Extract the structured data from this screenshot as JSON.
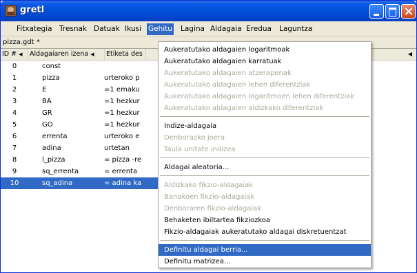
{
  "window": {
    "title": "gretl"
  },
  "menubar": {
    "items": [
      {
        "label": "Fitxategia",
        "active": false
      },
      {
        "label": "Tresnak",
        "active": false
      },
      {
        "label": "Datuak",
        "active": false
      },
      {
        "label": "Ikusi",
        "active": false
      },
      {
        "label": "Gehitu",
        "active": true
      },
      {
        "label": "Lagina",
        "active": false
      },
      {
        "label": "Aldagaia",
        "active": false
      },
      {
        "label": "Eredua",
        "active": false
      },
      {
        "label": "Laguntza",
        "active": false
      }
    ]
  },
  "file": {
    "name": "pizza.gdt *"
  },
  "table": {
    "headers": {
      "id": "ID #",
      "name": "Aldagaiaren izena",
      "label": "Etiketa des"
    },
    "rows": [
      {
        "id": "0",
        "name": "const",
        "label": ""
      },
      {
        "id": "1",
        "name": "pizza",
        "label": "urteroko p"
      },
      {
        "id": "2",
        "name": "E",
        "label": "=1 emaku"
      },
      {
        "id": "3",
        "name": "BA",
        "label": "=1 hezkur"
      },
      {
        "id": "4",
        "name": "GR",
        "label": "=1 hezkur"
      },
      {
        "id": "5",
        "name": "GO",
        "label": "=1 hezkur"
      },
      {
        "id": "6",
        "name": "errenta",
        "label": "urteroko e"
      },
      {
        "id": "7",
        "name": "adina",
        "label": "urtetan"
      },
      {
        "id": "8",
        "name": "l_pizza",
        "label": "= pizza -re"
      },
      {
        "id": "9",
        "name": "sq_errenta",
        "label": "= errenta"
      },
      {
        "id": "10",
        "name": "sq_adina",
        "label": "= adina ka"
      }
    ],
    "selected_row": 10
  },
  "dropdown": {
    "groups": [
      [
        {
          "label": "Aukeratutako aldagaien logaritmoak",
          "enabled": true
        },
        {
          "label": "Aukeratutako aldagaien karratuak",
          "enabled": true
        },
        {
          "label": "Aukeratutako aldagaien atzerapenak",
          "enabled": false
        },
        {
          "label": "Aukeratutako aldagaien lehen diferentziak",
          "enabled": false
        },
        {
          "label": "Aukeratutako aldagaien logaritmoen lehen diferentziak",
          "enabled": false
        },
        {
          "label": "Aukeratutako aldagaien aldizkako diferentziak",
          "enabled": false
        }
      ],
      [
        {
          "label": "Indize-aldagaia",
          "enabled": true
        },
        {
          "label": "Denborazko joera",
          "enabled": false
        },
        {
          "label": "Taula unitate indizea",
          "enabled": false
        }
      ],
      [
        {
          "label": "Aldagai aleatoria...",
          "enabled": true
        }
      ],
      [
        {
          "label": "Aldizkako fikzio-aldagaiak",
          "enabled": false
        },
        {
          "label": "Banakoen fikzio-aldagaiak",
          "enabled": false
        },
        {
          "label": "Denboraren fikzio-aldagaiak",
          "enabled": false
        },
        {
          "label": "Behaketen ibiltartea fikziozkoa",
          "enabled": true
        },
        {
          "label": "Fikzio-aldagaiak aukeratutako aldagai diskretuentzat",
          "enabled": true
        }
      ],
      [
        {
          "label": "Definitu aldagai berria...",
          "enabled": true,
          "highlighted": true
        },
        {
          "label": "Definitu matrizea...",
          "enabled": true
        }
      ]
    ]
  },
  "colors": {
    "selection": "#316ac5",
    "disabled_text": "#aca899",
    "titlebar": "#0450d8"
  }
}
